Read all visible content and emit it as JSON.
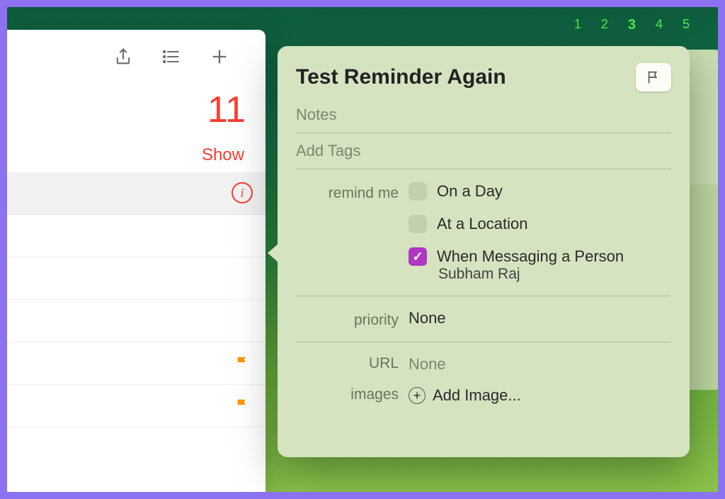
{
  "calendar_strip": [
    "1",
    "2",
    "3",
    "4",
    "5"
  ],
  "list": {
    "count": "11",
    "show": "Show"
  },
  "popover": {
    "title": "Test Reminder Again",
    "notes_placeholder": "Notes",
    "tags_placeholder": "Add Tags",
    "labels": {
      "remind_me": "remind me",
      "priority": "priority",
      "url": "URL",
      "images": "images"
    },
    "remind_options": {
      "on_day": "On a Day",
      "at_location": "At a Location",
      "messaging": "When Messaging a Person",
      "messaging_person": "Subham Raj"
    },
    "priority_value": "None",
    "url_value": "None",
    "add_image": "Add Image..."
  }
}
